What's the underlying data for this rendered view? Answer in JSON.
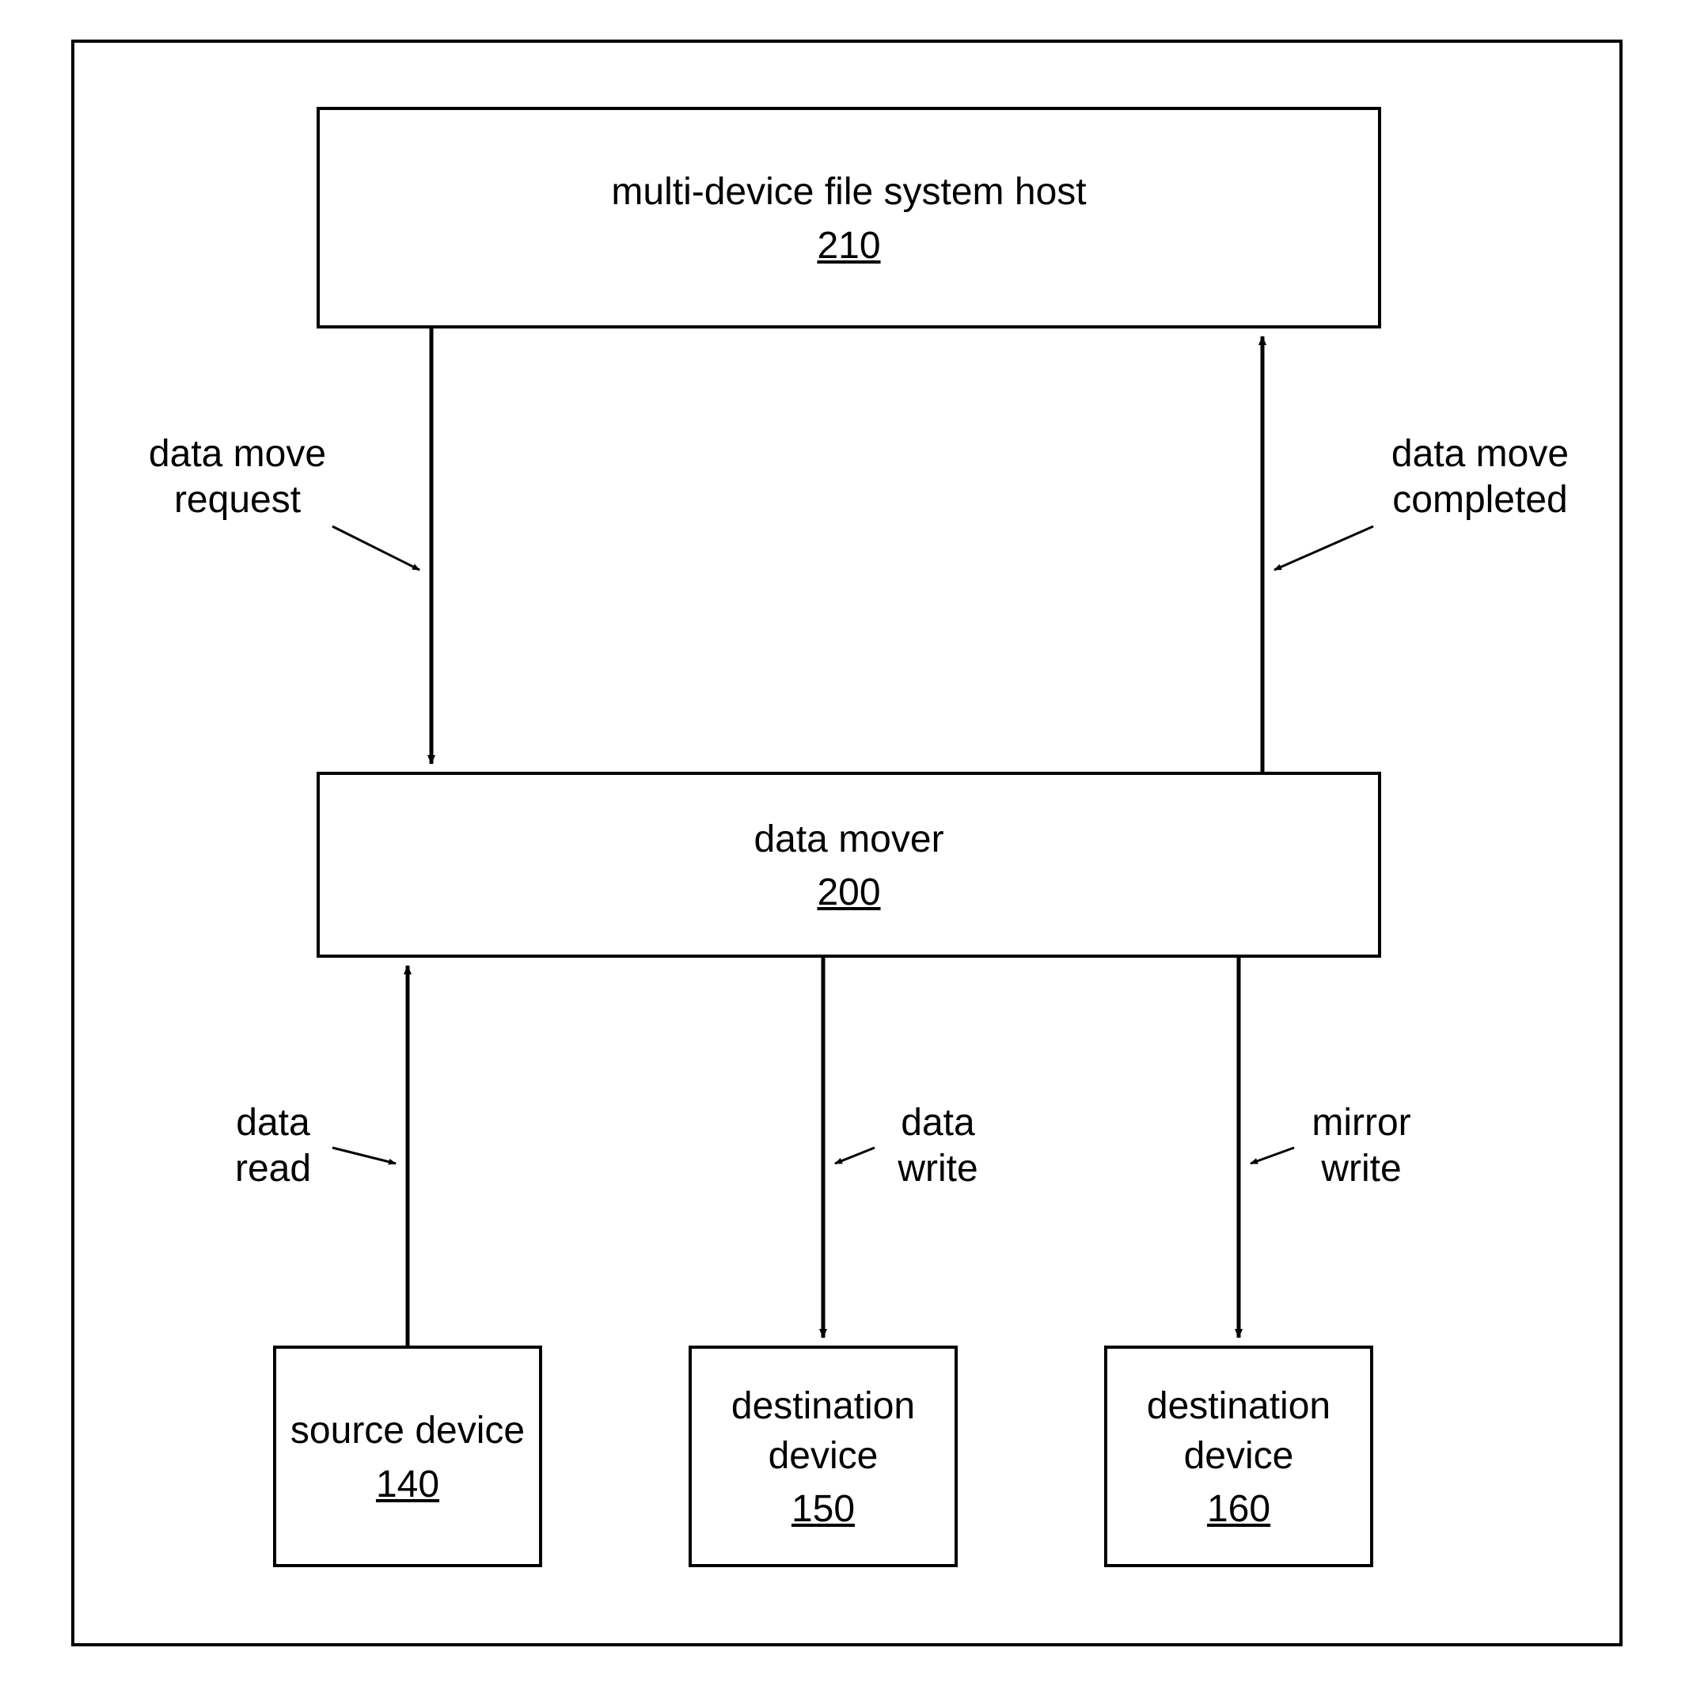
{
  "boxes": {
    "host": {
      "title": "multi-device file system host",
      "ref": "210"
    },
    "mover": {
      "title": "data mover",
      "ref": "200"
    },
    "source": {
      "title": "source device",
      "ref": "140"
    },
    "dest1": {
      "title_l1": "destination",
      "title_l2": "device",
      "ref": "150"
    },
    "dest2": {
      "title_l1": "destination",
      "title_l2": "device",
      "ref": "160"
    }
  },
  "labels": {
    "request_l1": "data move",
    "request_l2": "request",
    "completed_l1": "data move",
    "completed_l2": "completed",
    "read_l1": "data",
    "read_l2": "read",
    "write_l1": "data",
    "write_l2": "write",
    "mirror_l1": "mirror",
    "mirror_l2": "write"
  }
}
